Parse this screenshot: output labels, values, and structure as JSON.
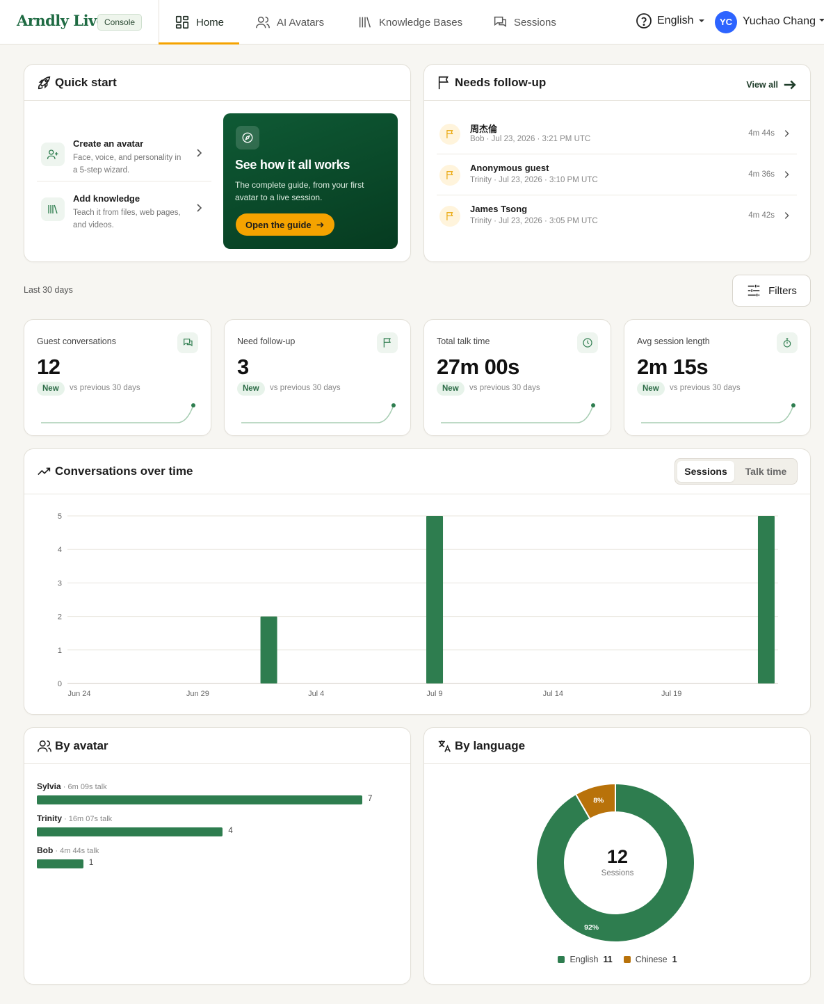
{
  "app": {
    "logo_text": "Arndly Live",
    "console_label": "Console"
  },
  "nav": {
    "items": [
      {
        "label": "Home",
        "icon": "dashboard-icon"
      },
      {
        "label": "AI Avatars",
        "icon": "users-icon"
      },
      {
        "label": "Knowledge Bases",
        "icon": "library-icon"
      },
      {
        "label": "Sessions",
        "icon": "chat-icon"
      }
    ],
    "language": "English",
    "user_initials": "YC",
    "user_name": "Yuchao Chang"
  },
  "quick_start": {
    "title": "Quick start",
    "items": [
      {
        "title": "Create an avatar",
        "desc": "Face, voice, and personality in a 5-step wizard."
      },
      {
        "title": "Add knowledge",
        "desc": "Teach it from files, web pages, and videos."
      }
    ],
    "guide": {
      "title": "See how it all works",
      "desc": "The complete guide, from your first avatar to a live session.",
      "button": "Open the guide"
    }
  },
  "follow_up": {
    "title": "Needs follow-up",
    "view_all": "View all",
    "rows": [
      {
        "name": "周杰倫",
        "meta": "Bob · Jul 23, 2026 · 3:21 PM UTC",
        "duration": "4m 44s"
      },
      {
        "name": "Anonymous guest",
        "meta": "Trinity · Jul 23, 2026 · 3:10 PM UTC",
        "duration": "4m 36s"
      },
      {
        "name": "James Tsong",
        "meta": "Trinity · Jul 23, 2026 · 3:05 PM UTC",
        "duration": "4m 42s"
      }
    ]
  },
  "range_label": "Last 30 days",
  "filters_label": "Filters",
  "stats": [
    {
      "label": "Guest conversations",
      "value": "12",
      "badge": "New",
      "vs": "vs previous 30 days",
      "icon": "chat-icon"
    },
    {
      "label": "Need follow-up",
      "value": "3",
      "badge": "New",
      "vs": "vs previous 30 days",
      "icon": "flag-icon"
    },
    {
      "label": "Total talk time",
      "value": "27m 00s",
      "badge": "New",
      "vs": "vs previous 30 days",
      "icon": "clock-icon"
    },
    {
      "label": "Avg session length",
      "value": "2m 15s",
      "badge": "New",
      "vs": "vs previous 30 days",
      "icon": "stopwatch-icon"
    }
  ],
  "conversations": {
    "title": "Conversations over time",
    "toggle": [
      "Sessions",
      "Talk time"
    ]
  },
  "by_avatar": {
    "title": "By avatar",
    "rows": [
      {
        "name": "Sylvia",
        "sub": "· 6m 09s talk",
        "count": 7
      },
      {
        "name": "Trinity",
        "sub": "· 16m 07s talk",
        "count": 4
      },
      {
        "name": "Bob",
        "sub": "· 4m 44s talk",
        "count": 1
      }
    ]
  },
  "by_language": {
    "title": "By language",
    "center_value": "12",
    "center_label": "Sessions",
    "legend": [
      {
        "name": "English",
        "count": "11",
        "color": "#2e7d4f"
      },
      {
        "name": "Chinese",
        "count": "1",
        "color": "#b8720a"
      }
    ]
  },
  "chart_data": [
    {
      "type": "bar",
      "title": "",
      "x": [
        "Jun 24",
        "Jun 25",
        "Jun 26",
        "Jun 27",
        "Jun 28",
        "Jun 29",
        "Jun 30",
        "Jul 1",
        "Jul 2",
        "Jul 3",
        "Jul 4",
        "Jul 5",
        "Jul 6",
        "Jul 7",
        "Jul 8",
        "Jul 9",
        "Jul 10",
        "Jul 11",
        "Jul 12",
        "Jul 13",
        "Jul 14",
        "Jul 15",
        "Jul 16",
        "Jul 17",
        "Jul 18",
        "Jul 19",
        "Jul 20",
        "Jul 21",
        "Jul 22",
        "Jul 23"
      ],
      "values": [
        0,
        0,
        0,
        0,
        0,
        0,
        0,
        0,
        2,
        0,
        0,
        0,
        0,
        0,
        0,
        5,
        0,
        0,
        0,
        0,
        0,
        0,
        0,
        0,
        0,
        0,
        0,
        0,
        0,
        5
      ],
      "xticks": [
        "Jun 24",
        "Jun 29",
        "Jul 4",
        "Jul 9",
        "Jul 14",
        "Jul 19"
      ],
      "yticks": [
        0,
        1,
        2,
        3,
        4,
        5
      ],
      "ylim": [
        0,
        5
      ],
      "grid": true,
      "color": "#2e7d4f"
    },
    {
      "type": "bar",
      "orientation": "horizontal",
      "categories": [
        "Sylvia",
        "Trinity",
        "Bob"
      ],
      "values": [
        7,
        4,
        1
      ],
      "color": "#2e7d4f"
    },
    {
      "type": "pie",
      "donut": true,
      "categories": [
        "English",
        "Chinese"
      ],
      "values": [
        11,
        1
      ],
      "labels": [
        "92%",
        "8%"
      ],
      "colors": [
        "#2e7d4f",
        "#b8720a"
      ]
    }
  ]
}
